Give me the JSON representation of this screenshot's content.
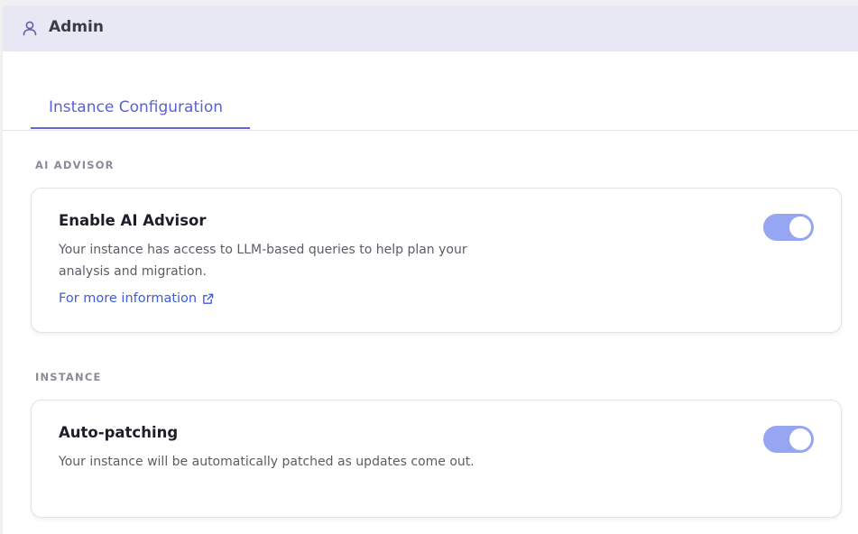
{
  "header": {
    "title": "Admin",
    "icon": "user-icon"
  },
  "tabs": [
    {
      "label": "Instance Configuration",
      "active": true
    }
  ],
  "sections": [
    {
      "label": "AI ADVISOR",
      "card": {
        "title": "Enable AI Advisor",
        "description": "Your instance has access to LLM-based queries to help plan your analysis and migration.",
        "link": {
          "label": "For more information",
          "icon": "external-link-icon"
        },
        "toggle": {
          "enabled": true
        }
      }
    },
    {
      "label": "INSTANCE",
      "card": {
        "title": "Auto-patching",
        "description": "Your instance will be automatically patched as updates come out.",
        "toggle": {
          "enabled": true
        }
      }
    }
  ],
  "colors": {
    "accent": "#5a62d1",
    "toggle_on": "#96a6f2",
    "link": "#3f5bd8",
    "header_bg": "#e8e8f4"
  }
}
